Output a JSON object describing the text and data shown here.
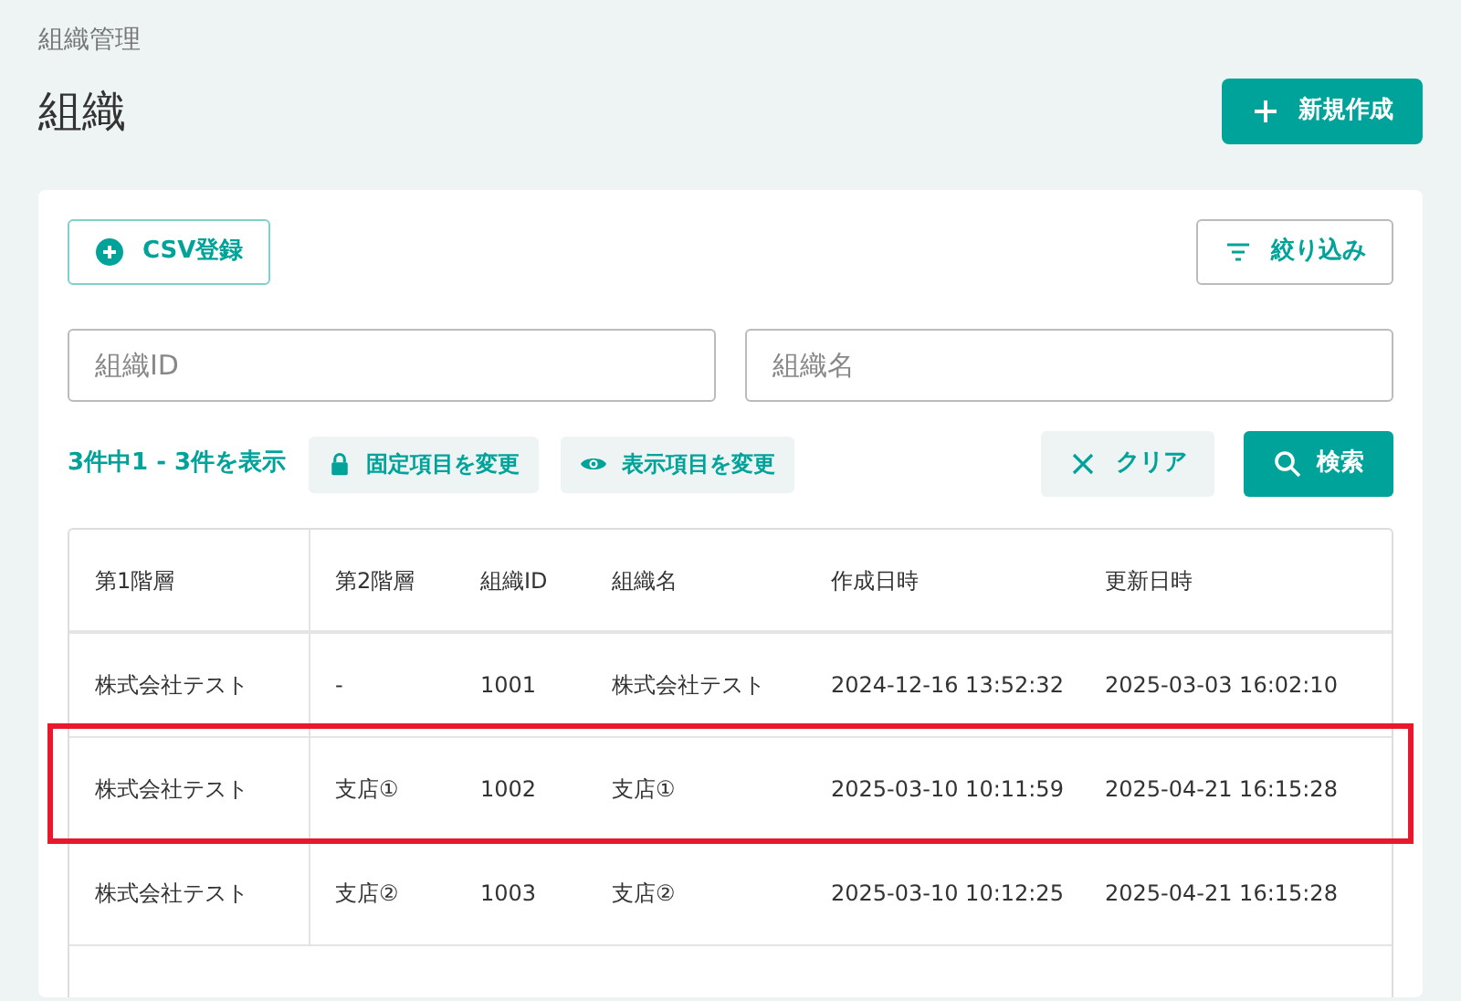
{
  "breadcrumb": "組織管理",
  "title": "組織",
  "create_button": "新規作成",
  "toolbar": {
    "csv_button": "CSV登録",
    "filter_button": "絞り込み"
  },
  "search": {
    "fields": [
      {
        "placeholder": "組織ID"
      },
      {
        "placeholder": "組織名"
      }
    ],
    "count": "3件中1 - 3件を表示",
    "fixed_button": "固定項目を変更",
    "display_button": "表示項目を変更",
    "clear_button": "クリア",
    "search_button": "検索"
  },
  "table": {
    "columns": [
      "第1階層",
      "第2階層",
      "組織ID",
      "組織名",
      "作成日時",
      "更新日時"
    ],
    "rows": [
      {
        "cells": [
          "株式会社テスト",
          "-",
          "1001",
          "株式会社テスト",
          "2024-12-16 13:52:32",
          "2025-03-03 16:02:10"
        ],
        "highlighted": false
      },
      {
        "cells": [
          "株式会社テスト",
          "支店①",
          "1002",
          "支店①",
          "2025-03-10 10:11:59",
          "2025-04-21 16:15:28"
        ],
        "highlighted": true
      },
      {
        "cells": [
          "株式会社テスト",
          "支店②",
          "1003",
          "支店②",
          "2025-03-10 10:12:25",
          "2025-04-21 16:15:28"
        ],
        "highlighted": false
      }
    ]
  }
}
